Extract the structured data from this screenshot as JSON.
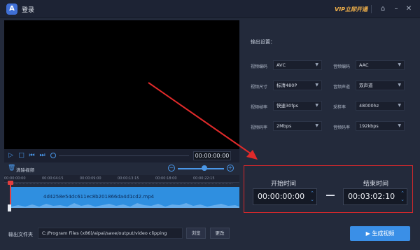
{
  "app": {
    "title": "登录",
    "vip_label": "VIP立即开通",
    "logo_glyph": "A"
  },
  "player": {
    "current_time": "00:00:00:00"
  },
  "clip": {
    "label": "清除视频",
    "file_name": "4d4258e54dc611ec8b201866da4d1cd2.mp4",
    "ruler_ticks": [
      "00:00:00:00",
      "00:00:04:15",
      "00:00:09:00",
      "00:00:13:15",
      "00:00:18:00",
      "00:00:22:15"
    ]
  },
  "settings": {
    "title": "输出设置：",
    "rows": [
      {
        "label": "视频编码",
        "value": "AVC",
        "label2": "音频编码",
        "value2": "AAC"
      },
      {
        "label": "视频尺寸",
        "value": "标清480P",
        "label2": "音频声道",
        "value2": "双声道"
      },
      {
        "label": "视频帧率",
        "value": "快速30fps",
        "label2": "采样率",
        "value2": "48000hz"
      },
      {
        "label": "视频码率",
        "value": "2Mbps",
        "label2": "音频码率",
        "value2": "192kbps"
      }
    ]
  },
  "range": {
    "start_label": "开始时间",
    "start_value": "00:00:00:00",
    "end_label": "结束时间",
    "end_value": "00:03:02:10"
  },
  "output": {
    "label": "输出文件夹",
    "path": "C:/Program Files (x86)/aipai/save/output/video clipping",
    "browse_label": "浏览",
    "change_label": "更改",
    "generate_label": "生成视频"
  },
  "colors": {
    "accent": "#3a8fe7",
    "highlight_border": "#d6282b",
    "annotation_arrow": "#e02a2a"
  }
}
